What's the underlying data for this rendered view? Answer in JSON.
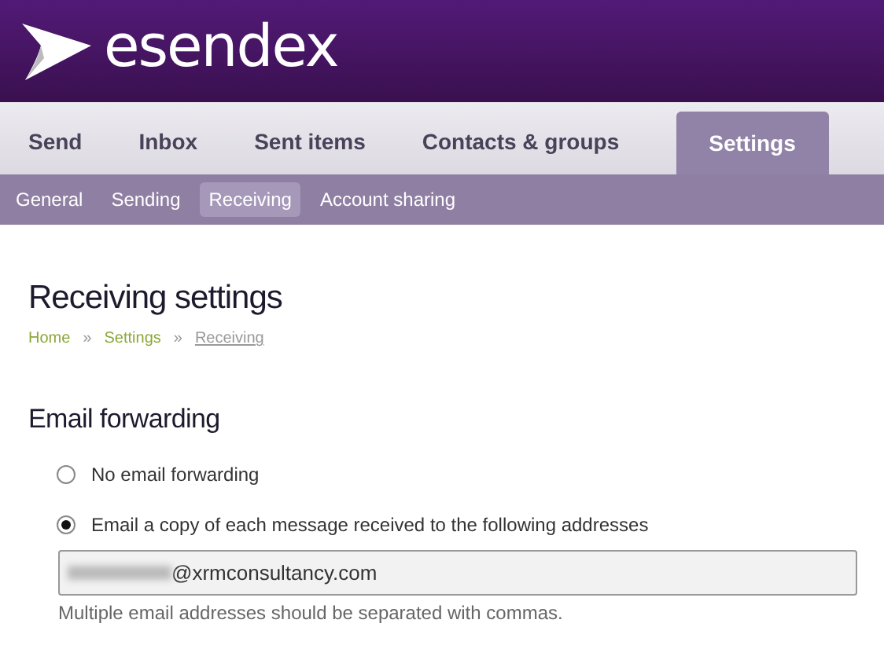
{
  "logo": {
    "wordmark": "esendex"
  },
  "tabs": [
    {
      "label": "Send",
      "selected": false
    },
    {
      "label": "Inbox",
      "selected": false
    },
    {
      "label": "Sent items",
      "selected": false
    },
    {
      "label": "Contacts & groups",
      "selected": false
    },
    {
      "label": "Settings",
      "selected": true
    }
  ],
  "subtabs": [
    {
      "label": "General",
      "selected": false
    },
    {
      "label": "Sending",
      "selected": false
    },
    {
      "label": "Receiving",
      "selected": true
    },
    {
      "label": "Account sharing",
      "selected": false
    }
  ],
  "page": {
    "title": "Receiving settings",
    "breadcrumb": [
      {
        "label": "Home",
        "current": false
      },
      {
        "label": "Settings",
        "current": false
      },
      {
        "label": "Receiving",
        "current": true
      }
    ],
    "breadcrumb_separator": "»",
    "section": "Email forwarding",
    "options": [
      {
        "label": "No email forwarding",
        "selected": false
      },
      {
        "label": "Email a copy of each message received to the following addresses",
        "selected": true
      }
    ],
    "address_field": {
      "value": "@xrmconsultancy.com",
      "redacted_prefix": true
    },
    "hint": "Multiple email addresses should be separated with commas."
  }
}
